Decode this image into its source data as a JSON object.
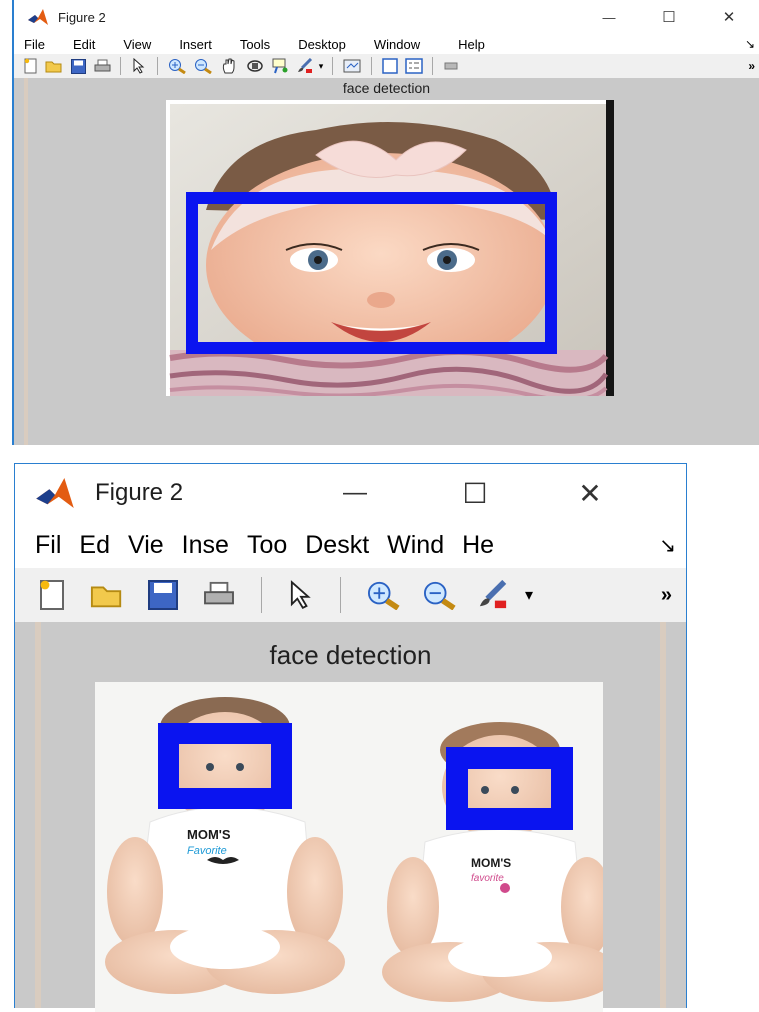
{
  "colors": {
    "detection_box": "#0a14f0",
    "canvas_bg": "#c9c9c9",
    "titlebar_bg": "#ffffff",
    "toolbar_bg": "#f0f0f0"
  },
  "windows": [
    {
      "title": "Figure 2",
      "menu": [
        "File",
        "Edit",
        "View",
        "Insert",
        "Tools",
        "Desktop",
        "Window",
        "Help"
      ],
      "menu_overflow": "↘",
      "toolbar_icons": [
        "new-figure-icon",
        "open-file-icon",
        "save-icon",
        "print-icon",
        "pointer-arrow-icon",
        "zoom-in-icon",
        "zoom-out-icon",
        "pan-hand-icon",
        "rotate-3d-icon",
        "data-cursor-icon",
        "brush-icon",
        "dropdown-arrow-icon",
        "link-plot-icon",
        "colorbar-icon",
        "legend-icon",
        "hide-tools-icon"
      ],
      "toolbar_overflow": "»",
      "axes_title": "face detection",
      "image": "baby with pink headband smiling",
      "detections": 1
    },
    {
      "title": "Figure 2",
      "menu": [
        "Fil",
        "Ed",
        "Vie",
        "Inse",
        "Too",
        "Deskt",
        "Wind",
        "He"
      ],
      "menu_overflow": "↘",
      "toolbar_icons": [
        "new-figure-icon",
        "open-file-icon",
        "save-icon",
        "print-icon",
        "pointer-arrow-icon",
        "zoom-in-icon",
        "zoom-out-icon",
        "brush-icon",
        "dropdown-arrow-icon"
      ],
      "toolbar_overflow": "»",
      "axes_title": "face detection",
      "image": "two babies sitting in white onesies",
      "detections": 2
    }
  ],
  "onesie_text": {
    "left_line1": "MOM'S",
    "left_line2": "Favorite",
    "right_line1": "MOM'S",
    "right_line2": "favorite"
  },
  "window_controls": {
    "minimize": "—",
    "maximize": "☐",
    "close": "✕"
  }
}
